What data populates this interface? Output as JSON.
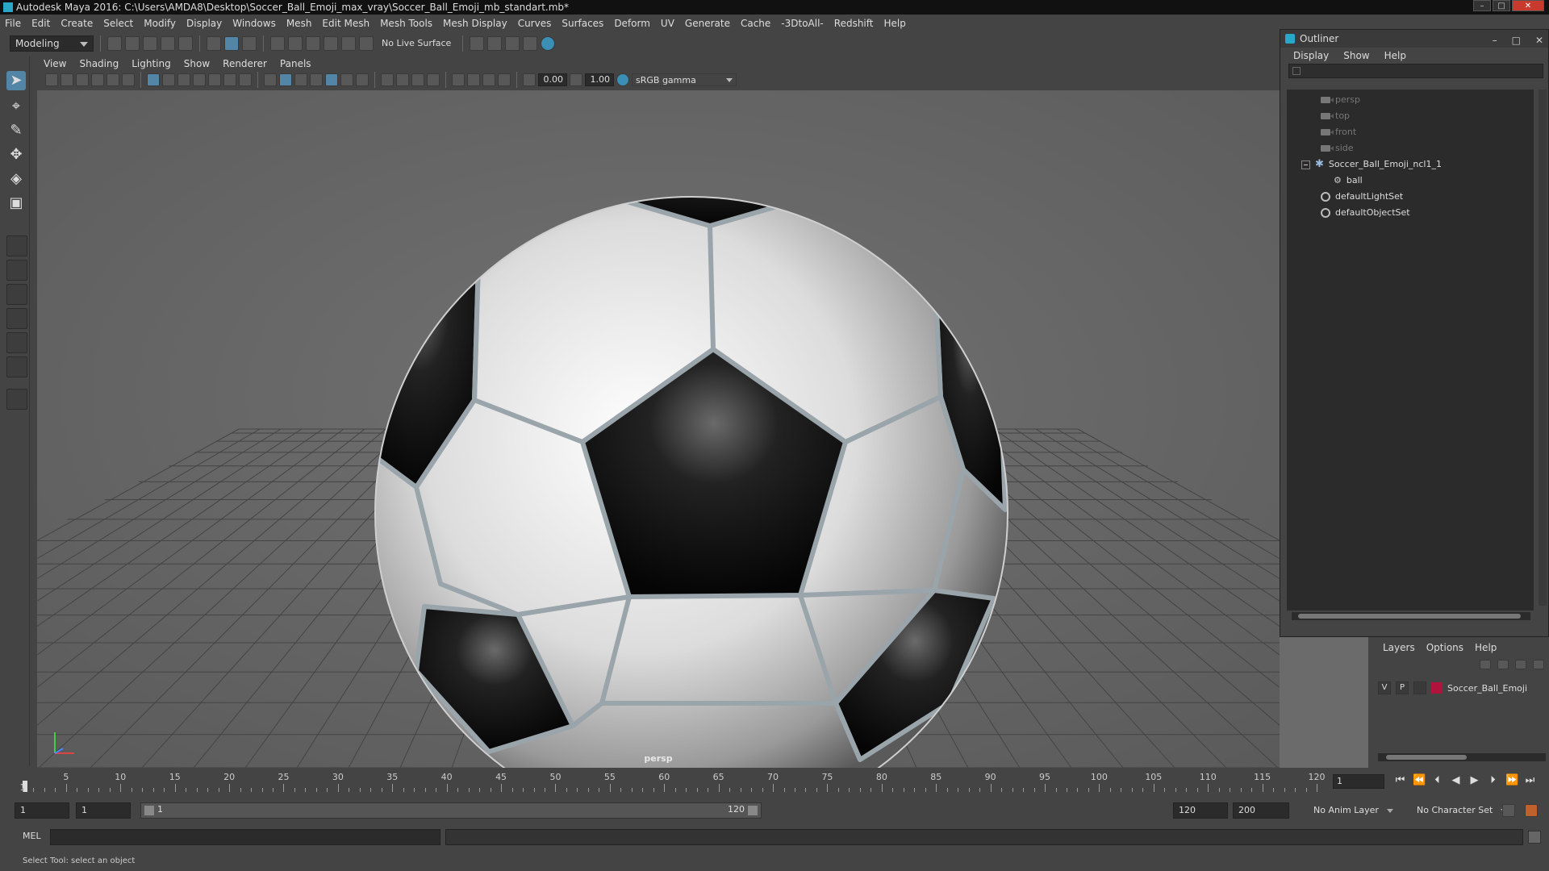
{
  "window": {
    "title": "Autodesk Maya 2016: C:\\Users\\AMDA8\\Desktop\\Soccer_Ball_Emoji_max_vray\\Soccer_Ball_Emoji_mb_standart.mb*"
  },
  "menubar": [
    "File",
    "Edit",
    "Create",
    "Select",
    "Modify",
    "Display",
    "Windows",
    "Mesh",
    "Edit Mesh",
    "Mesh Tools",
    "Mesh Display",
    "Curves",
    "Surfaces",
    "Deform",
    "UV",
    "Generate",
    "Cache",
    "-3DtoAll-",
    "Redshift",
    "Help"
  ],
  "shelf": {
    "mode": "Modeling",
    "live_surface": "No Live Surface"
  },
  "viewport": {
    "menu": [
      "View",
      "Shading",
      "Lighting",
      "Show",
      "Renderer",
      "Panels"
    ],
    "exposure": "0.00",
    "gamma": "1.00",
    "color_space": "sRGB gamma",
    "camera_label": "persp"
  },
  "outliner": {
    "title": "Outliner",
    "menu": [
      "Display",
      "Show",
      "Help"
    ],
    "items": [
      "persp",
      "top",
      "front",
      "side",
      "Soccer_Ball_Emoji_ncl1_1",
      "ball",
      "defaultLightSet",
      "defaultObjectSet"
    ]
  },
  "layers": {
    "menu": [
      "Layers",
      "Options",
      "Help"
    ],
    "row": {
      "v": "V",
      "p": "P",
      "name": "Soccer_Ball_Emoji",
      "color": "#b0143c"
    }
  },
  "timeline": {
    "ticks": [
      "5",
      "10",
      "15",
      "20",
      "25",
      "30",
      "35",
      "40",
      "45",
      "50",
      "55",
      "60",
      "65",
      "70",
      "75",
      "80",
      "85",
      "90",
      "95",
      "100",
      "105",
      "110",
      "115",
      "120"
    ],
    "start_marker": "1",
    "current_frame": "1"
  },
  "range": {
    "start": "1",
    "start_inner": "1",
    "slider_start": "1",
    "slider_end": "120",
    "end_inner": "120",
    "end": "200",
    "anim_layer": "No Anim Layer",
    "char_set": "No Character Set"
  },
  "cmdline": {
    "label": "MEL"
  },
  "helpline": {
    "text": "Select Tool: select an object"
  },
  "colors": {
    "accent": "#5285a6",
    "maya_teal": "#2aa6c8"
  }
}
